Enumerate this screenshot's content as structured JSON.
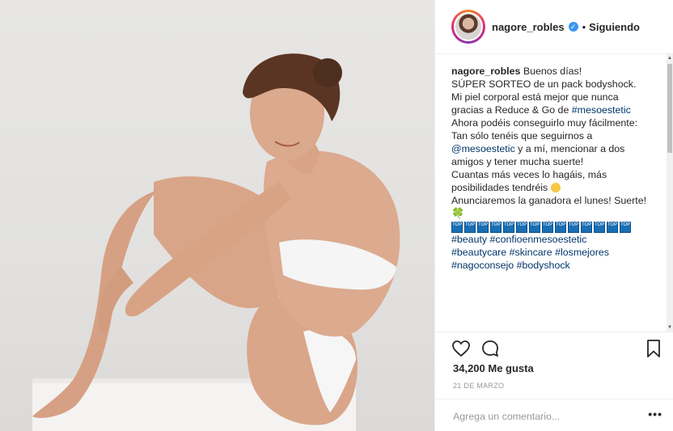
{
  "post": {
    "username": "nagore_robles",
    "follow_status": "Siguiendo",
    "separator": "•",
    "verified_icon": "verified-badge-icon"
  },
  "caption": {
    "username": "nagore_robles",
    "lines": [
      "Buenos días!",
      "SÚPER SORTEO de un pack bodyshock.",
      "Mi piel corporal está mejor que nunca",
      "gracias a Reduce & Go de ",
      "Ahora podéis conseguirlo muy fácilmente:",
      "Tan sólo tenéis que seguirnos a",
      "y a mí, mencionar a dos",
      "amigos y tener mucha suerte!",
      "Cuantas más veces lo hagáis, más",
      "posibilidades tendréis",
      "Anunciaremos la ganadora el lunes! Suerte!"
    ],
    "tag_mesoestetic": "#mesoestetic",
    "mention_mesoestetic": "@mesoestetic",
    "emoji_clover": "🍀",
    "emoji_top_label": "TOP",
    "hashtag_line1": "#beauty #confioenmesoestetic",
    "hashtag_line2": "#beautycare #skincare #losmejores",
    "hashtag_line3": "#nagoconsejo #bodyshock"
  },
  "stats": {
    "likes": "34,200 Me gusta",
    "date": "21 DE MARZO"
  },
  "comment": {
    "placeholder": "Agrega un comentario...",
    "more": "•••"
  },
  "icons": {
    "like": "heart-icon",
    "comment": "comment-icon",
    "save": "bookmark-icon",
    "more": "more-options-icon"
  }
}
